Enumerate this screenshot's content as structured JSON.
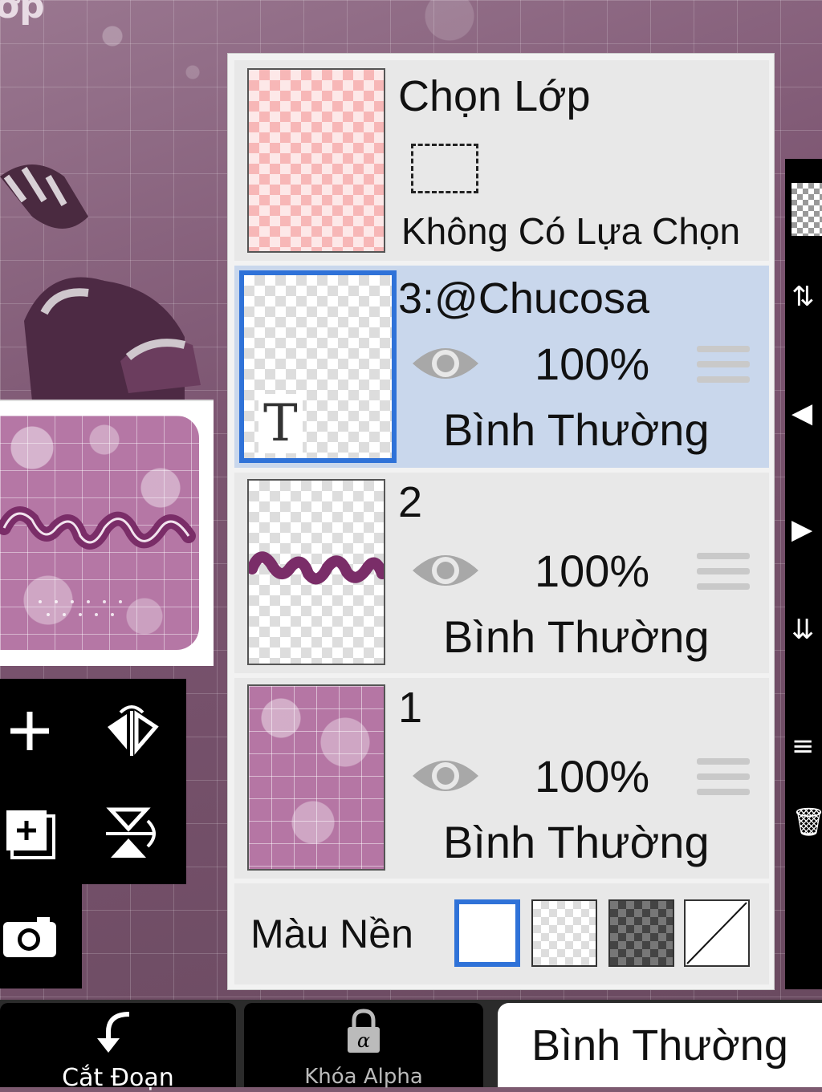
{
  "canvas": {
    "title_fragment": "ớp"
  },
  "layer_panel": {
    "selection_row": {
      "title": "Chọn Lớp",
      "status": "Không Có Lựa Chọn"
    },
    "layers": [
      {
        "name": "3:@Chucosa",
        "opacity": "100%",
        "blend": "Bình Thường",
        "visible": true,
        "selected": true,
        "thumb_badge": "T",
        "thumb_icon": "text-layer-icon"
      },
      {
        "name": "2",
        "opacity": "100%",
        "blend": "Bình Thường",
        "visible": true,
        "selected": false
      },
      {
        "name": "1",
        "opacity": "100%",
        "blend": "Bình Thường",
        "visible": true,
        "selected": false
      }
    ],
    "background": {
      "label": "Màu Nền",
      "options": [
        "white",
        "checker-light",
        "checker-dark",
        "none"
      ],
      "selected": "white"
    }
  },
  "left_tools": {
    "icons": [
      "add-layer-icon",
      "flip-horizontal-icon",
      "duplicate-layer-icon",
      "flip-vertical-icon",
      "camera-icon"
    ]
  },
  "bottom_bar": {
    "clip_label": "Cắt Đoạn",
    "alpha_lock_label": "Khóa Alpha",
    "alpha_lock_glyph": "α",
    "blend_mode": "Bình Thường"
  },
  "colors": {
    "selected_row": "#c9d7ec",
    "selection_accent": "#2f72d8",
    "panel_bg": "#e8e8e8",
    "canvas_purple": "#7d5a70"
  }
}
